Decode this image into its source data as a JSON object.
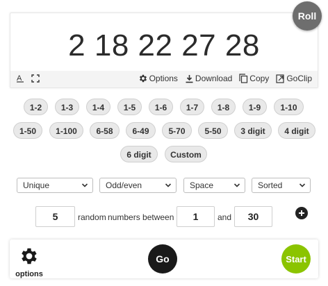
{
  "roll_label": "Roll",
  "result": "2 18 22 27 28",
  "toolbar": {
    "options": "Options",
    "download": "Download",
    "copy": "Copy",
    "goclip": "GoClip"
  },
  "presets": {
    "row1": [
      "1-2",
      "1-3",
      "1-4",
      "1-5",
      "1-6",
      "1-7",
      "1-8",
      "1-9",
      "1-10"
    ],
    "row2": [
      "1-50",
      "1-100",
      "6-58",
      "6-49",
      "5-70",
      "5-50",
      "3 digit",
      "4 digit"
    ],
    "row3": [
      "6 digit",
      "Custom"
    ]
  },
  "selects": {
    "unique": "Unique",
    "oddeven": "Odd/even",
    "space": "Space",
    "sorted": "Sorted"
  },
  "config": {
    "count": "5",
    "text_random": "random",
    "text_between": "numbers between",
    "min": "1",
    "text_and": "and",
    "max": "30"
  },
  "bottom": {
    "options_label": "options",
    "go_label": "Go",
    "start_label": "Start"
  },
  "colors": {
    "roll_button": "#6e6e6e",
    "go_button": "#1a1a1a",
    "start_button": "#8bc400"
  }
}
